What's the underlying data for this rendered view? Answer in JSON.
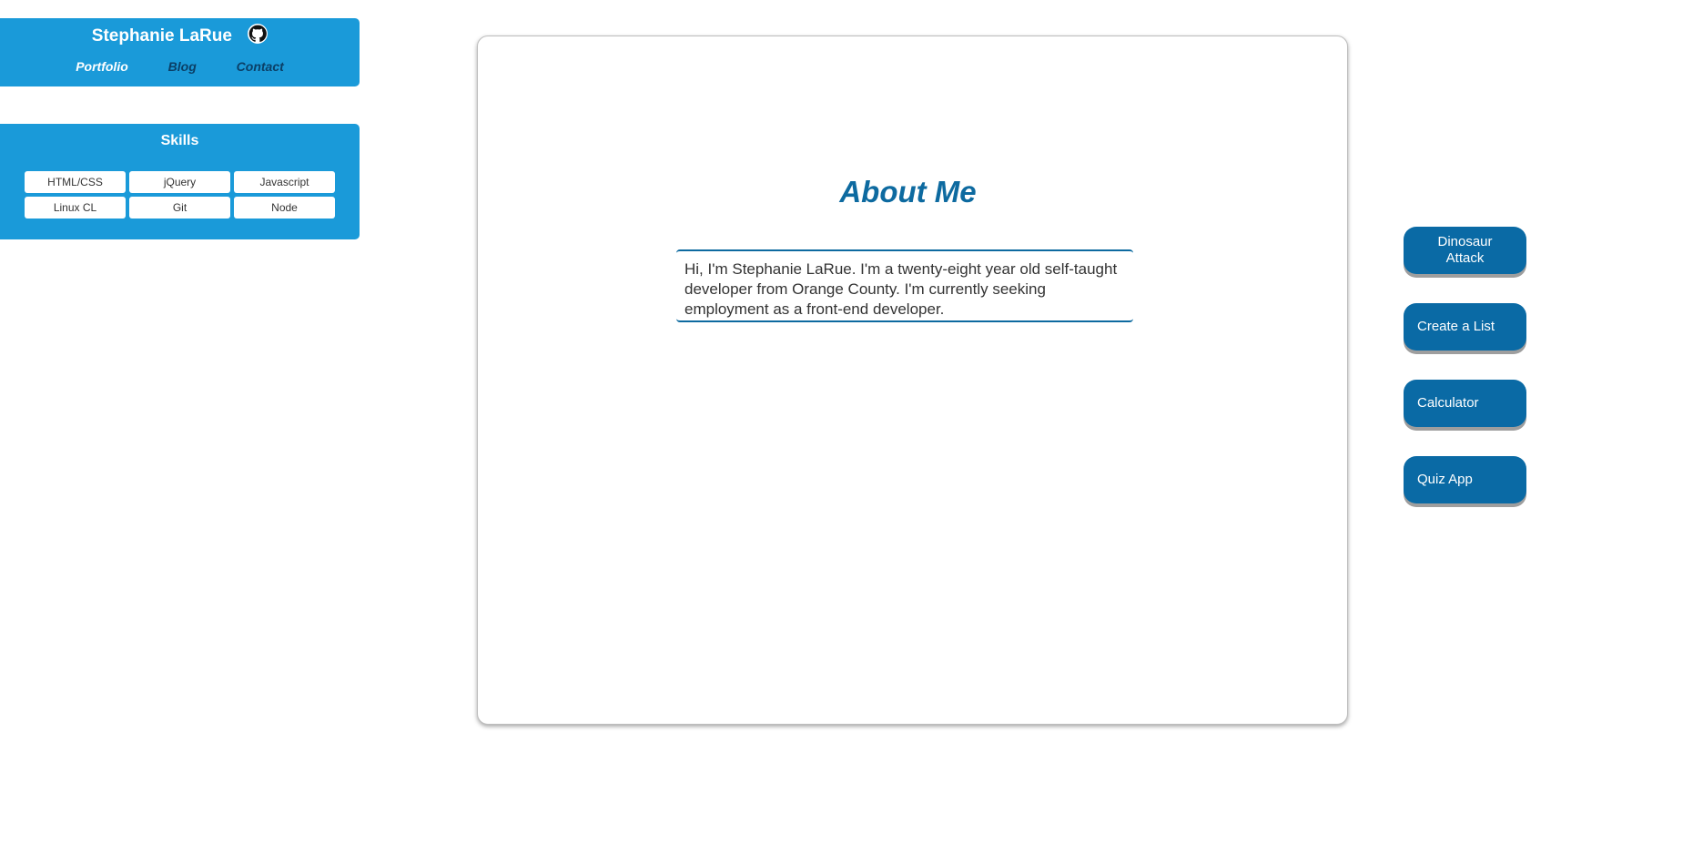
{
  "header": {
    "name": "Stephanie LaRue",
    "github_icon": "github-icon",
    "nav": {
      "portfolio": "Portfolio",
      "blog": "Blog",
      "contact": "Contact"
    }
  },
  "skills": {
    "title": "Skills",
    "items": [
      "HTML/CSS",
      "jQuery",
      "Javascript",
      "Linux CL",
      "Git",
      "Node"
    ]
  },
  "about": {
    "title": "About Me",
    "text": "Hi, I'm Stephanie LaRue. I'm a twenty-eight year old self-taught developer from Orange County. I'm currently seeking employment as a front-end developer."
  },
  "projects": {
    "items": [
      "Dinosaur Attack",
      "Create a List",
      "Calculator",
      "Quiz App"
    ]
  },
  "colors": {
    "card_blue": "#1a9ad9",
    "button_blue": "#0a6aa5",
    "heading_blue": "#0d6aa0"
  }
}
